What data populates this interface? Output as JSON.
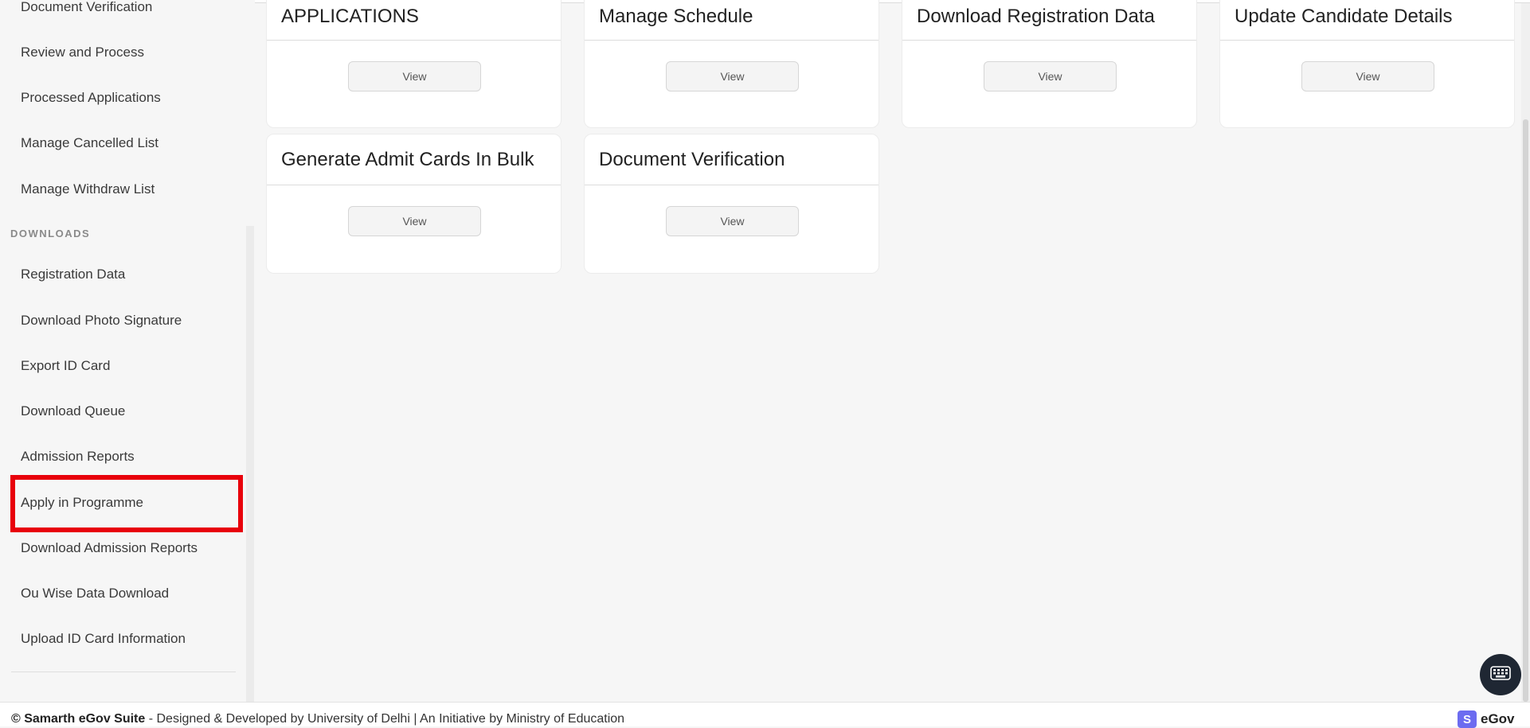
{
  "sidebar": {
    "items_top": [
      {
        "label": "Document Verification"
      },
      {
        "label": "Review and Process"
      },
      {
        "label": "Processed Applications"
      },
      {
        "label": "Manage Cancelled List"
      },
      {
        "label": "Manage Withdraw List"
      }
    ],
    "section_downloads": "DOWNLOADS",
    "items_downloads": [
      {
        "label": "Registration Data"
      },
      {
        "label": "Download Photo Signature"
      },
      {
        "label": "Export ID Card"
      },
      {
        "label": "Download Queue"
      },
      {
        "label": "Admission Reports"
      },
      {
        "label": "Apply in Programme"
      },
      {
        "label": "Download Admission Reports"
      },
      {
        "label": "Ou Wise Data Download"
      },
      {
        "label": "Upload ID Card Information"
      }
    ]
  },
  "cards": [
    {
      "title": "APPLICATIONS",
      "button": "View"
    },
    {
      "title": "Manage Schedule",
      "button": "View"
    },
    {
      "title": "Download Registration Data",
      "button": "View"
    },
    {
      "title": "Update Candidate Details",
      "button": "View"
    },
    {
      "title": "Generate Admit Cards In Bulk",
      "button": "View"
    },
    {
      "title": "Document Verification",
      "button": "View"
    }
  ],
  "footer": {
    "brand": "© Samarth eGov Suite",
    "text": " - Designed & Developed by University of Delhi | An Initiative by Ministry of Education",
    "logo_letter": "S",
    "logo_text": "eGov"
  },
  "colors": {
    "highlight": "#e8000b",
    "logo": "#6c6cf0"
  },
  "icons": {
    "keyboard": "keyboard-icon"
  }
}
